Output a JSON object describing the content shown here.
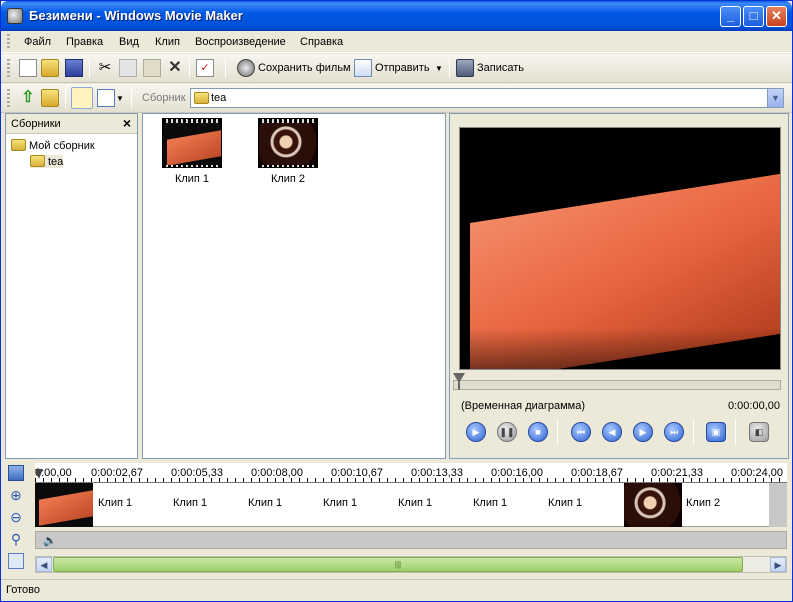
{
  "window": {
    "title": "Безимени - Windows Movie Maker",
    "minimize": "_",
    "maximize": "□",
    "close": "✕"
  },
  "menu": [
    "Файл",
    "Правка",
    "Вид",
    "Клип",
    "Воспроизведение",
    "Справка"
  ],
  "toolbar": {
    "save_movie": "Сохранить фильм",
    "send": "Отправить",
    "record": "Записать"
  },
  "collection_bar": {
    "label": "Сборник",
    "value": "tea"
  },
  "collections_panel": {
    "title": "Сборники",
    "root": "Мой сборник",
    "child": "tea"
  },
  "clips": [
    {
      "name": "Клип 1"
    },
    {
      "name": "Клип 2"
    }
  ],
  "preview": {
    "label": "(Временная диаграмма)",
    "time": "0:00:00,00"
  },
  "timeline": {
    "ticks": [
      "0:00,00",
      "0:00:02,67",
      "0:00:05,33",
      "0:00:08,00",
      "0:00:10,67",
      "0:00:13,33",
      "0:00:16,00",
      "0:00:18,67",
      "0:00:21,33",
      "0:00:24,00"
    ],
    "video_clip_labels": [
      "Клип 1",
      "Клип 1",
      "Клип 1",
      "Клип 1",
      "Клип 1",
      "Клип 1",
      "Клип 1",
      "Клип 2"
    ],
    "audio_icon": "🔈"
  },
  "status": {
    "text": "Готово"
  }
}
